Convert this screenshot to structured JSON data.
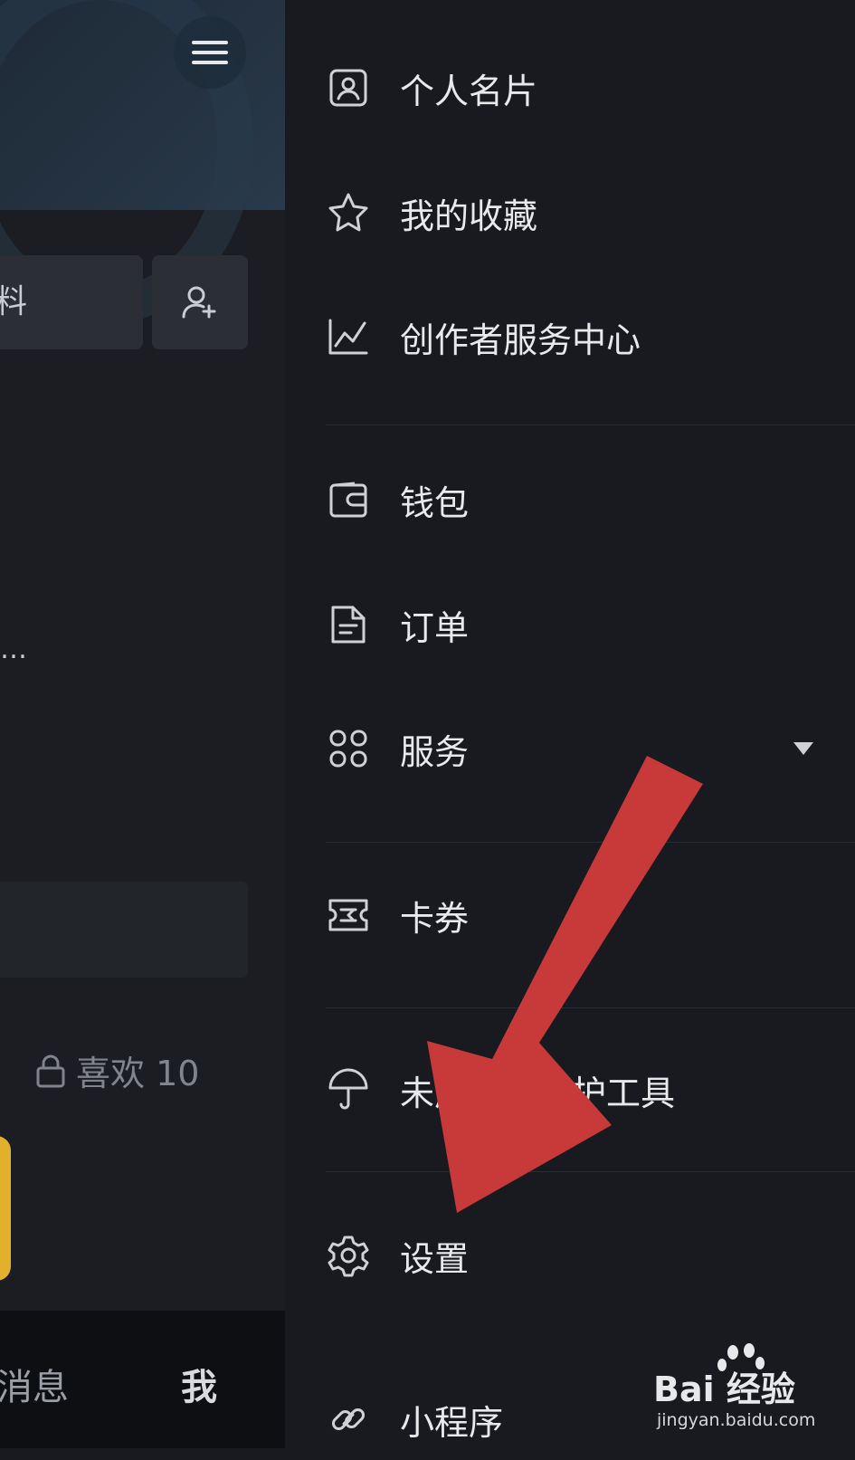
{
  "profile": {
    "edit_button_fragment": "料",
    "truncated_text": "…",
    "likes_label": "喜欢 10"
  },
  "tabbar": {
    "messages": "消息",
    "me": "我"
  },
  "drawer": {
    "items": [
      {
        "label": "个人名片",
        "icon": "id-card-icon"
      },
      {
        "label": "我的收藏",
        "icon": "star-icon"
      },
      {
        "label": "创作者服务中心",
        "icon": "chart-line-icon"
      },
      {
        "label": "钱包",
        "icon": "wallet-icon"
      },
      {
        "label": "订单",
        "icon": "document-icon"
      },
      {
        "label": "服务",
        "icon": "grid-icon"
      },
      {
        "label": "卡券",
        "icon": "ticket-icon"
      },
      {
        "label": "未成年人保护工具",
        "icon": "umbrella-icon"
      },
      {
        "label": "设置",
        "icon": "gear-icon"
      },
      {
        "label": "小程序",
        "icon": "link-icon"
      }
    ]
  },
  "watermark": {
    "brand": "Bai 经验",
    "url": "jingyan.baidu.com"
  },
  "colors": {
    "drawer_bg": "#181a20",
    "arrow": "#c8393a",
    "accent_yellow": "#e1b12c"
  }
}
